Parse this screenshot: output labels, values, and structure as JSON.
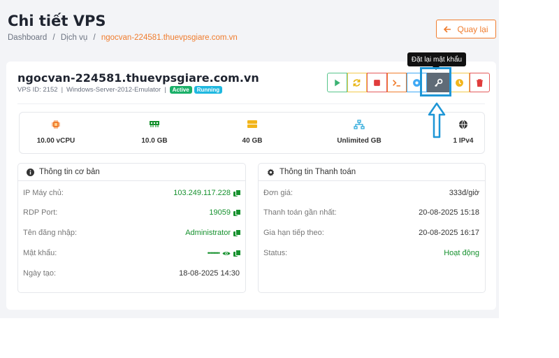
{
  "page": {
    "title": "Chi tiết VPS",
    "breadcrumb": [
      "Dashboard",
      "Dịch vụ",
      "ngocvan-224581.thuevpsgiare.com.vn"
    ],
    "breadcrumb_sep": "/",
    "back_label": "Quay lại"
  },
  "tooltip": "Đặt lại mật khẩu",
  "vps": {
    "hostname": "ngocvan-224581.thuevpsgiare.com.vn",
    "id_text": "VPS ID: 2152",
    "os": "Windows-Server-2012-Emulator",
    "sep": "|",
    "badges": [
      "Active",
      "Running"
    ]
  },
  "actions": [
    "play-icon",
    "restart-icon",
    "stop-icon",
    "console-icon",
    "network-icon",
    "key-icon",
    "clock-icon",
    "trash-icon"
  ],
  "stats": [
    {
      "icon": "cpu-icon",
      "value": "10.00 vCPU"
    },
    {
      "icon": "ram-icon",
      "value": "10.0 GB"
    },
    {
      "icon": "disk-icon",
      "value": "40 GB"
    },
    {
      "icon": "network-icon",
      "value": "Unlimited GB"
    },
    {
      "icon": "globe-icon",
      "value": "1 IPv4"
    }
  ],
  "basic": {
    "title": "Thông tin cơ bản",
    "rows": [
      {
        "label": "IP Máy chủ:",
        "value": "103.249.117.228"
      },
      {
        "label": "RDP Port:",
        "value": "19059"
      },
      {
        "label": "Tên đăng nhập:",
        "value": "Administrator"
      },
      {
        "label": "Mật khẩu:",
        "value": "••••••••"
      },
      {
        "label": "Ngày tạo:",
        "value": "18-08-2025 14:30"
      }
    ]
  },
  "billing": {
    "title": "Thông tin Thanh toán",
    "rows": [
      {
        "label": "Đơn giá:",
        "value": "333đ/giờ"
      },
      {
        "label": "Thanh toán gần nhất:",
        "value": "20-08-2025 15:18"
      },
      {
        "label": "Gia hạn tiếp theo:",
        "value": "20-08-2025 16:17"
      },
      {
        "label": "Status:",
        "value": "Hoạt động"
      }
    ]
  },
  "colors": {
    "accent": "#f07c2d",
    "green": "#16912e",
    "highlight": "#1e96d6"
  }
}
